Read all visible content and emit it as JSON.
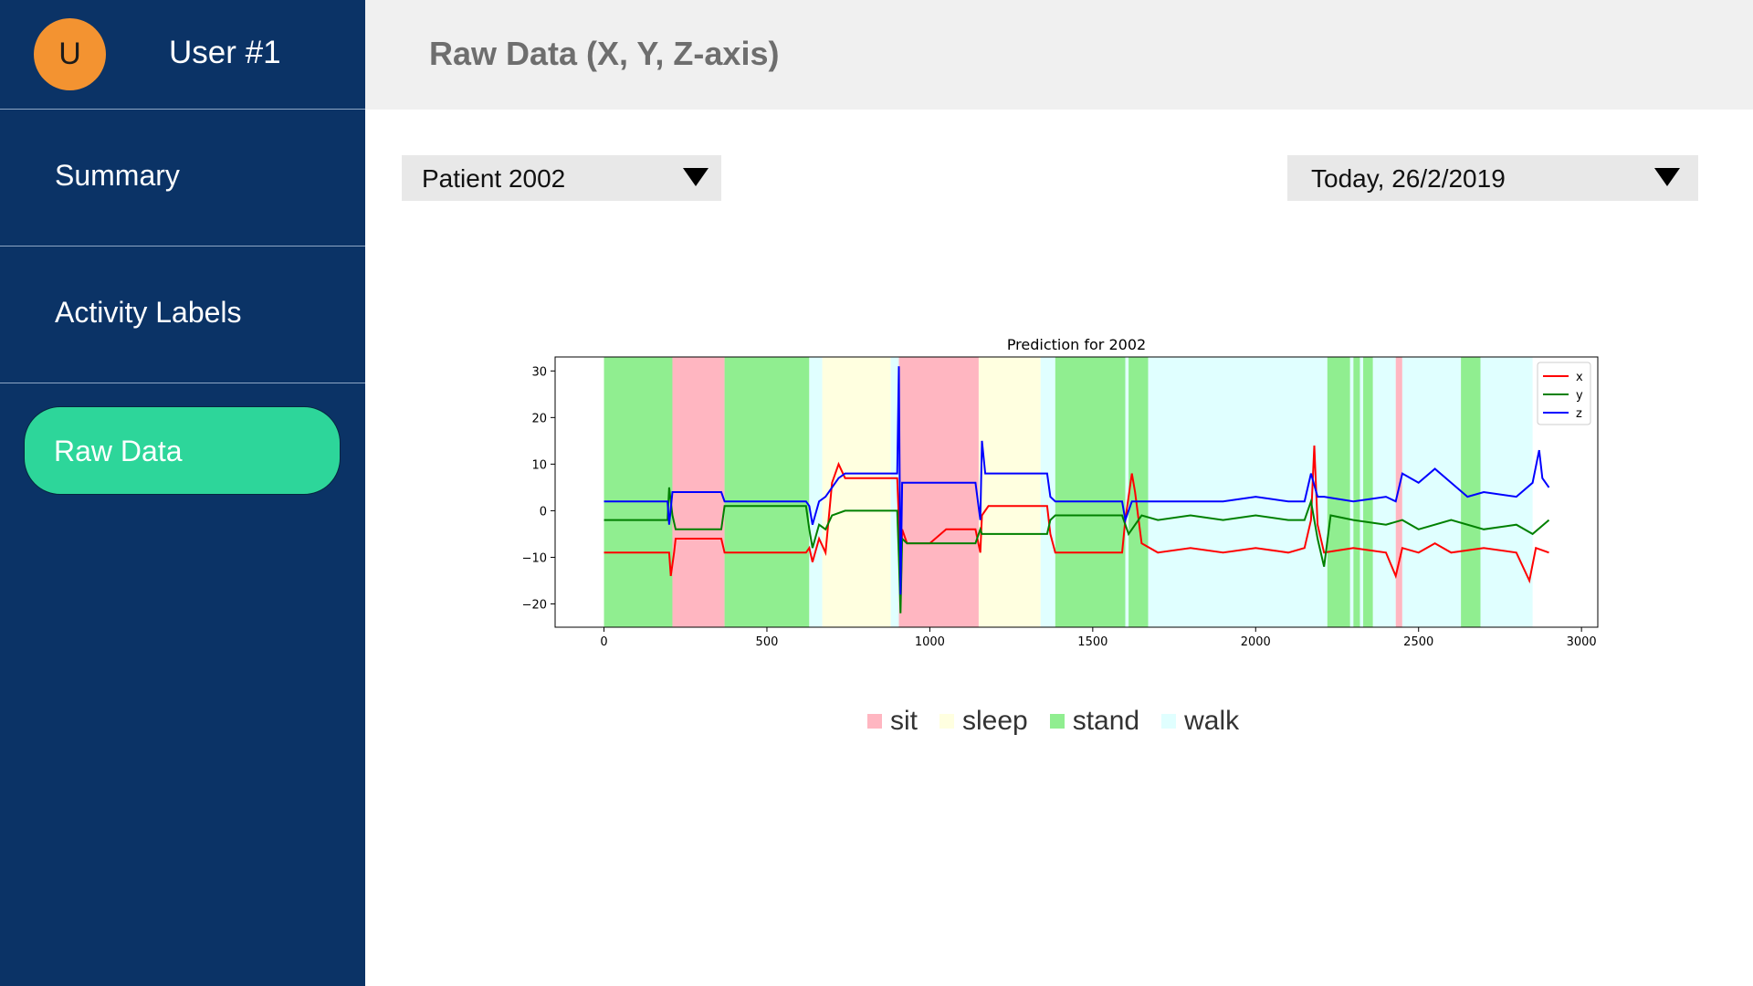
{
  "sidebar": {
    "avatar_initial": "U",
    "user_name": "User #1",
    "items": [
      {
        "label": "Summary"
      },
      {
        "label": "Activity Labels"
      },
      {
        "label": "Raw Data",
        "active": true
      }
    ]
  },
  "header": {
    "title": "Raw Data (X, Y, Z-axis)"
  },
  "filters": {
    "patient": "Patient 2002",
    "date": "Today, 26/2/2019"
  },
  "colors": {
    "sidebar_bg": "#0b3366",
    "active_item": "#2dd69a",
    "avatar": "#f39331",
    "sit": "#ffb6c1",
    "sleep": "#ffffe0",
    "stand": "#90ee90",
    "walk": "#e0ffff",
    "x": "#ff0000",
    "y": "#008000",
    "z": "#0000ff"
  },
  "activity_legend": [
    {
      "label": "sit",
      "color": "#ffb6c1"
    },
    {
      "label": "sleep",
      "color": "#ffffe0"
    },
    {
      "label": "stand",
      "color": "#90ee90"
    },
    {
      "label": "walk",
      "color": "#e0ffff"
    }
  ],
  "chart_data": {
    "type": "line",
    "title": "Prediction for 2002",
    "xlabel": "",
    "ylabel": "",
    "xlim": [
      -150,
      3050
    ],
    "ylim": [
      -25,
      33
    ],
    "xticks": [
      0,
      500,
      1000,
      1500,
      2000,
      2500,
      3000
    ],
    "yticks": [
      -20,
      -10,
      0,
      10,
      20,
      30
    ],
    "legend_position": "top-right",
    "grid": false,
    "series": [
      {
        "name": "x",
        "color": "#ff0000",
        "points": [
          [
            0,
            -9
          ],
          [
            100,
            -9
          ],
          [
            200,
            -9
          ],
          [
            205,
            -14
          ],
          [
            215,
            -9
          ],
          [
            220,
            -6
          ],
          [
            360,
            -6
          ],
          [
            370,
            -9
          ],
          [
            380,
            -9
          ],
          [
            620,
            -9
          ],
          [
            630,
            -8
          ],
          [
            640,
            -11
          ],
          [
            660,
            -6
          ],
          [
            680,
            -9
          ],
          [
            700,
            6
          ],
          [
            720,
            10
          ],
          [
            740,
            7
          ],
          [
            900,
            7
          ],
          [
            905,
            -2
          ],
          [
            910,
            -20
          ],
          [
            915,
            -4
          ],
          [
            930,
            -7
          ],
          [
            1000,
            -7
          ],
          [
            1050,
            -4
          ],
          [
            1140,
            -4
          ],
          [
            1155,
            -9
          ],
          [
            1160,
            -1
          ],
          [
            1180,
            1
          ],
          [
            1360,
            1
          ],
          [
            1370,
            -5
          ],
          [
            1385,
            -9
          ],
          [
            1400,
            -9
          ],
          [
            1590,
            -9
          ],
          [
            1600,
            -2
          ],
          [
            1620,
            8
          ],
          [
            1630,
            4
          ],
          [
            1650,
            -7
          ],
          [
            1700,
            -9
          ],
          [
            1800,
            -8
          ],
          [
            1900,
            -9
          ],
          [
            2000,
            -8
          ],
          [
            2100,
            -9
          ],
          [
            2150,
            -8
          ],
          [
            2170,
            -2
          ],
          [
            2180,
            14
          ],
          [
            2190,
            -3
          ],
          [
            2210,
            -9
          ],
          [
            2300,
            -8
          ],
          [
            2400,
            -9
          ],
          [
            2430,
            -14
          ],
          [
            2450,
            -8
          ],
          [
            2500,
            -9
          ],
          [
            2550,
            -7
          ],
          [
            2600,
            -9
          ],
          [
            2700,
            -8
          ],
          [
            2800,
            -9
          ],
          [
            2840,
            -15
          ],
          [
            2860,
            -8
          ],
          [
            2900,
            -9
          ]
        ]
      },
      {
        "name": "y",
        "color": "#008000",
        "points": [
          [
            0,
            -2
          ],
          [
            100,
            -2
          ],
          [
            195,
            -2
          ],
          [
            200,
            5
          ],
          [
            210,
            -1
          ],
          [
            220,
            -4
          ],
          [
            360,
            -4
          ],
          [
            370,
            1
          ],
          [
            380,
            1
          ],
          [
            620,
            1
          ],
          [
            630,
            -4
          ],
          [
            640,
            -8
          ],
          [
            660,
            -3
          ],
          [
            680,
            -4
          ],
          [
            700,
            -1
          ],
          [
            740,
            0
          ],
          [
            900,
            0
          ],
          [
            905,
            -10
          ],
          [
            910,
            -22
          ],
          [
            915,
            -6
          ],
          [
            930,
            -7
          ],
          [
            1140,
            -7
          ],
          [
            1155,
            -4
          ],
          [
            1160,
            -5
          ],
          [
            1360,
            -5
          ],
          [
            1370,
            -2
          ],
          [
            1385,
            -1
          ],
          [
            1590,
            -1
          ],
          [
            1610,
            -5
          ],
          [
            1650,
            -1
          ],
          [
            1700,
            -2
          ],
          [
            1800,
            -1
          ],
          [
            1900,
            -2
          ],
          [
            2000,
            -1
          ],
          [
            2100,
            -2
          ],
          [
            2150,
            -2
          ],
          [
            2170,
            2
          ],
          [
            2190,
            -6
          ],
          [
            2210,
            -12
          ],
          [
            2230,
            -1
          ],
          [
            2300,
            -2
          ],
          [
            2400,
            -3
          ],
          [
            2450,
            -2
          ],
          [
            2500,
            -4
          ],
          [
            2600,
            -2
          ],
          [
            2700,
            -4
          ],
          [
            2800,
            -3
          ],
          [
            2850,
            -5
          ],
          [
            2900,
            -2
          ]
        ]
      },
      {
        "name": "z",
        "color": "#0000ff",
        "points": [
          [
            0,
            2
          ],
          [
            100,
            2
          ],
          [
            195,
            2
          ],
          [
            200,
            -3
          ],
          [
            210,
            4
          ],
          [
            220,
            4
          ],
          [
            360,
            4
          ],
          [
            370,
            2
          ],
          [
            380,
            2
          ],
          [
            620,
            2
          ],
          [
            630,
            1
          ],
          [
            640,
            -3
          ],
          [
            660,
            2
          ],
          [
            680,
            3
          ],
          [
            700,
            5
          ],
          [
            720,
            7
          ],
          [
            740,
            8
          ],
          [
            900,
            8
          ],
          [
            905,
            31
          ],
          [
            910,
            -18
          ],
          [
            915,
            6
          ],
          [
            930,
            6
          ],
          [
            1140,
            6
          ],
          [
            1155,
            -2
          ],
          [
            1160,
            15
          ],
          [
            1170,
            8
          ],
          [
            1360,
            8
          ],
          [
            1370,
            3
          ],
          [
            1385,
            2
          ],
          [
            1590,
            2
          ],
          [
            1600,
            -2
          ],
          [
            1620,
            2
          ],
          [
            1650,
            2
          ],
          [
            1700,
            2
          ],
          [
            1800,
            2
          ],
          [
            1900,
            2
          ],
          [
            2000,
            3
          ],
          [
            2100,
            2
          ],
          [
            2150,
            2
          ],
          [
            2170,
            8
          ],
          [
            2190,
            3
          ],
          [
            2210,
            3
          ],
          [
            2300,
            2
          ],
          [
            2400,
            3
          ],
          [
            2430,
            2
          ],
          [
            2450,
            8
          ],
          [
            2500,
            6
          ],
          [
            2550,
            9
          ],
          [
            2600,
            6
          ],
          [
            2650,
            3
          ],
          [
            2700,
            4
          ],
          [
            2800,
            3
          ],
          [
            2850,
            6
          ],
          [
            2870,
            13
          ],
          [
            2880,
            7
          ],
          [
            2900,
            5
          ]
        ]
      }
    ],
    "activity_spans": [
      {
        "activity": "stand",
        "start": 0,
        "end": 210
      },
      {
        "activity": "sit",
        "start": 210,
        "end": 370
      },
      {
        "activity": "stand",
        "start": 370,
        "end": 630
      },
      {
        "activity": "walk",
        "start": 630,
        "end": 670
      },
      {
        "activity": "sleep",
        "start": 670,
        "end": 880
      },
      {
        "activity": "walk",
        "start": 880,
        "end": 905
      },
      {
        "activity": "sit",
        "start": 905,
        "end": 1150
      },
      {
        "activity": "sleep",
        "start": 1150,
        "end": 1340
      },
      {
        "activity": "walk",
        "start": 1340,
        "end": 1385
      },
      {
        "activity": "stand",
        "start": 1385,
        "end": 1600
      },
      {
        "activity": "walk",
        "start": 1600,
        "end": 1610
      },
      {
        "activity": "stand",
        "start": 1610,
        "end": 1670
      },
      {
        "activity": "walk",
        "start": 1670,
        "end": 2220
      },
      {
        "activity": "stand",
        "start": 2220,
        "end": 2290
      },
      {
        "activity": "walk",
        "start": 2290,
        "end": 2300
      },
      {
        "activity": "stand",
        "start": 2300,
        "end": 2320
      },
      {
        "activity": "walk",
        "start": 2320,
        "end": 2330
      },
      {
        "activity": "stand",
        "start": 2330,
        "end": 2360
      },
      {
        "activity": "walk",
        "start": 2360,
        "end": 2430
      },
      {
        "activity": "sit",
        "start": 2430,
        "end": 2450
      },
      {
        "activity": "walk",
        "start": 2450,
        "end": 2630
      },
      {
        "activity": "stand",
        "start": 2630,
        "end": 2690
      },
      {
        "activity": "walk",
        "start": 2690,
        "end": 2850
      }
    ]
  }
}
